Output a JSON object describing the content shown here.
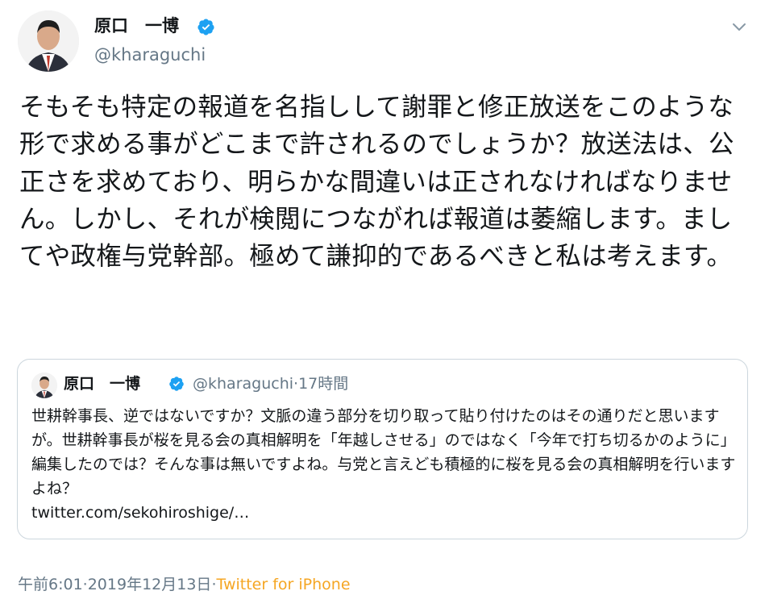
{
  "author": {
    "display_name": "原口　一博",
    "handle": "@kharaguchi"
  },
  "tweet": {
    "text": "そもそも特定の報道を名指しして謝罪と修正放送をこのような形で求める事がどこまで許されるのでしょうか？放送法は、公正さを求めており、明らかな間違いは正されなければなりません。しかし、それが検閲につながれば報道は萎縮します。ましてや政権与党幹部。極めて謙抑的であるべきと私は考えます。"
  },
  "quoted_tweet": {
    "display_name": "原口　一博",
    "handle": "@kharaguchi",
    "separator": " · ",
    "time_ago": "17時間",
    "text": "世耕幹事長、逆ではないですか？文脈の違う部分を切り取って貼り付けたのはその通りだと思いますが。世耕幹事長が桜を見る会の真相解明を「年越しさせる」のではなく「今年で打ち切るかのように」編集したのでは？そんな事は無いですよね。与党と言えども積極的に桜を見る会の真相解明を行いますよね？",
    "link": "twitter.com/sekohiroshige/…"
  },
  "footer": {
    "time": "午前6:01",
    "separator": " · ",
    "date": "2019年12月13日",
    "separator2": " · ",
    "source": "Twitter for iPhone"
  },
  "icons": {
    "verified": "verified-badge-icon",
    "caret": "chevron-down-icon"
  },
  "colors": {
    "verified_blue": "#1da1f2",
    "text": "#14171a",
    "secondary": "#657786",
    "source_link": "#f5a623",
    "border": "#ccd6dd"
  }
}
